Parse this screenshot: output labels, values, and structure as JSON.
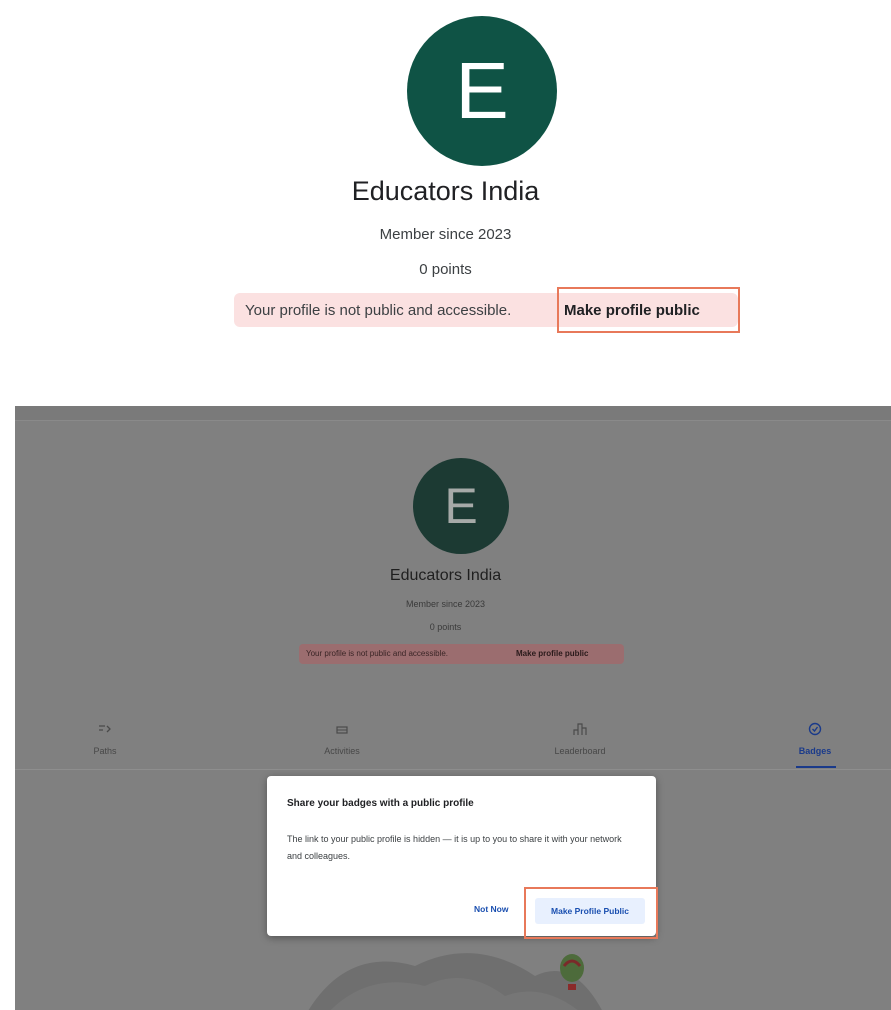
{
  "profile": {
    "initial": "E",
    "name": "Educators India",
    "member_since": "Member since 2023",
    "points": "0 points",
    "notice_text": "Your profile is not public and accessible.",
    "notice_link": "Make profile public"
  },
  "tabs": [
    {
      "label": "Paths",
      "icon": "paths-icon"
    },
    {
      "label": "Activities",
      "icon": "activities-icon"
    },
    {
      "label": "Leaderboard",
      "icon": "leaderboard-icon"
    },
    {
      "label": "Badges",
      "icon": "badges-icon",
      "active": true
    }
  ],
  "dialog": {
    "title": "Share your badges with a public profile",
    "body": "The link to your public profile is hidden — it is up to you to share it with your network and colleagues.",
    "secondary_button": "Not Now",
    "primary_button": "Make Profile Public"
  },
  "colors": {
    "avatar": "#0f5345",
    "notice_bg": "#fbe1e1",
    "highlight": "#e8795a",
    "accent": "#1a4fb0"
  }
}
